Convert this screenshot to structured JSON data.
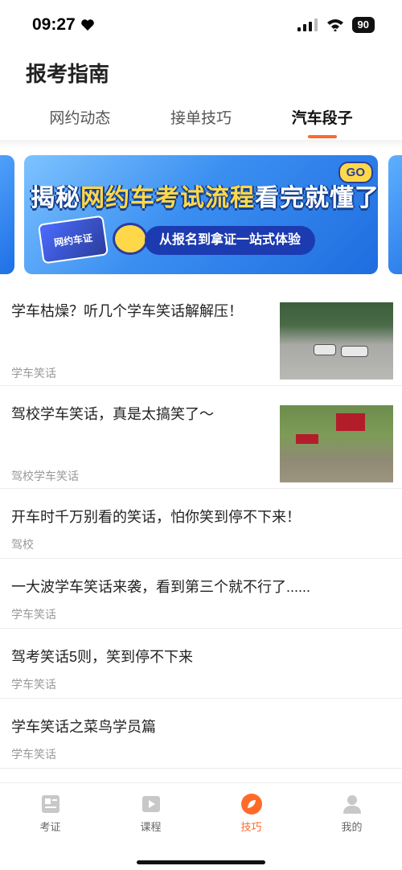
{
  "status_bar": {
    "time": "09:27",
    "battery": "90"
  },
  "header": {
    "title": "报考指南"
  },
  "tabs": [
    {
      "label": "网约动态",
      "active": false
    },
    {
      "label": "接单技巧",
      "active": false
    },
    {
      "label": "汽车段子",
      "active": true
    }
  ],
  "banner": {
    "title_part1": "揭秘",
    "title_highlight": "网约车考试流程",
    "title_part2": "看完就懂了",
    "go": "GO",
    "card_text": "网约车证",
    "subtitle": "从报名到拿证一站式体验"
  },
  "articles": [
    {
      "title": "学车枯燥？听几个学车笑话解解压！",
      "tag": "学车笑话",
      "has_image": true
    },
    {
      "title": "驾校学车笑话，真是太搞笑了～",
      "tag": "驾校学车笑话",
      "has_image": true
    },
    {
      "title": "开车时千万别看的笑话，怕你笑到停不下来！",
      "tag": "驾校",
      "has_image": false
    },
    {
      "title": "一大波学车笑话来袭，看到第三个就不行了......",
      "tag": "学车笑话",
      "has_image": false
    },
    {
      "title": "驾考笑话5则，笑到停不下来",
      "tag": "学车笑话",
      "has_image": false
    },
    {
      "title": "学车笑话之菜鸟学员篇",
      "tag": "学车笑话",
      "has_image": false
    }
  ],
  "bottom_nav": [
    {
      "label": "考证",
      "icon": "exam-icon",
      "active": false
    },
    {
      "label": "课程",
      "icon": "course-video-icon",
      "active": false
    },
    {
      "label": "技巧",
      "icon": "compass-leaf-icon",
      "active": true
    },
    {
      "label": "我的",
      "icon": "profile-icon",
      "active": false
    }
  ],
  "colors": {
    "accent": "#ff6a2b",
    "banner_blue": "#3b8ff1",
    "text_gray": "#999999"
  }
}
